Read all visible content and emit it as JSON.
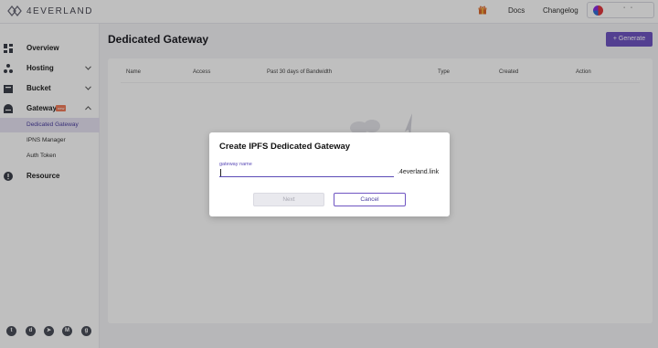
{
  "brand": {
    "name": "4EVERLAND"
  },
  "header": {
    "gift_icon": "gift-icon",
    "links": [
      "Docs",
      "Changelog"
    ],
    "account_icon": "user-avatar-icon"
  },
  "sidebar": {
    "items": [
      {
        "label": "Overview",
        "icon": "overview-grid-icon"
      },
      {
        "label": "Hosting",
        "icon": "hosting-nodes-icon",
        "expandable": true
      },
      {
        "label": "Bucket",
        "icon": "bucket-icon",
        "expandable": true
      },
      {
        "label": "Gateway",
        "icon": "gateway-icon",
        "expandable": true,
        "expanded": true,
        "badge": "new",
        "children": [
          {
            "label": "Dedicated Gateway",
            "active": true
          },
          {
            "label": "IPNS Manager"
          },
          {
            "label": "Auth Token"
          }
        ]
      },
      {
        "label": "Resource",
        "icon": "resource-info-icon"
      }
    ],
    "socials": [
      {
        "name": "twitter-icon",
        "glyph": "t"
      },
      {
        "name": "discord-icon",
        "glyph": "d"
      },
      {
        "name": "telegram-icon",
        "glyph": "➤"
      },
      {
        "name": "medium-icon",
        "glyph": "M"
      },
      {
        "name": "github-icon",
        "glyph": "g"
      }
    ]
  },
  "main": {
    "title": "Dedicated Gateway",
    "generate_button": "+ Generate",
    "table": {
      "columns": [
        "Name",
        "Access",
        "Past 30 days of Bandwidth",
        "Type",
        "Created",
        "Action"
      ]
    }
  },
  "modal": {
    "title": "Create IPFS Dedicated Gateway",
    "field_label": "gateway name",
    "input_value": "",
    "suffix": ".4everland.link",
    "next_label": "Next",
    "cancel_label": "Cancel"
  },
  "colors": {
    "accent": "#6f55c2",
    "active_bg": "#e7e3f3",
    "badge": "#ef7b5a"
  }
}
